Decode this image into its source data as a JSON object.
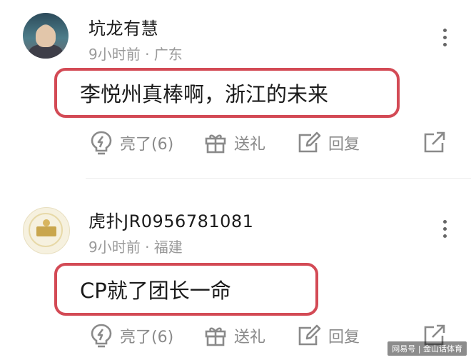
{
  "comments": [
    {
      "username": "坑龙有慧",
      "meta": "9小时前 · 广东",
      "text": "李悦州真棒啊，浙江的未来",
      "like_label": "亮了(6)",
      "gift_label": "送礼",
      "reply_label": "回复"
    },
    {
      "username": "虎扑JR0956781081",
      "meta": "9小时前 · 福建",
      "text": "CP就了团长一命",
      "like_label": "亮了(6)",
      "gift_label": "送礼",
      "reply_label": "回复"
    }
  ],
  "watermark": "网易号 | 金山话体育",
  "colors": {
    "highlight_border": "#d34a55",
    "meta_text": "#9a9a9a",
    "action_text": "#8a8a8a"
  },
  "icons": [
    "lightbulb-icon",
    "gift-icon",
    "edit-icon",
    "share-icon",
    "more-icon"
  ]
}
